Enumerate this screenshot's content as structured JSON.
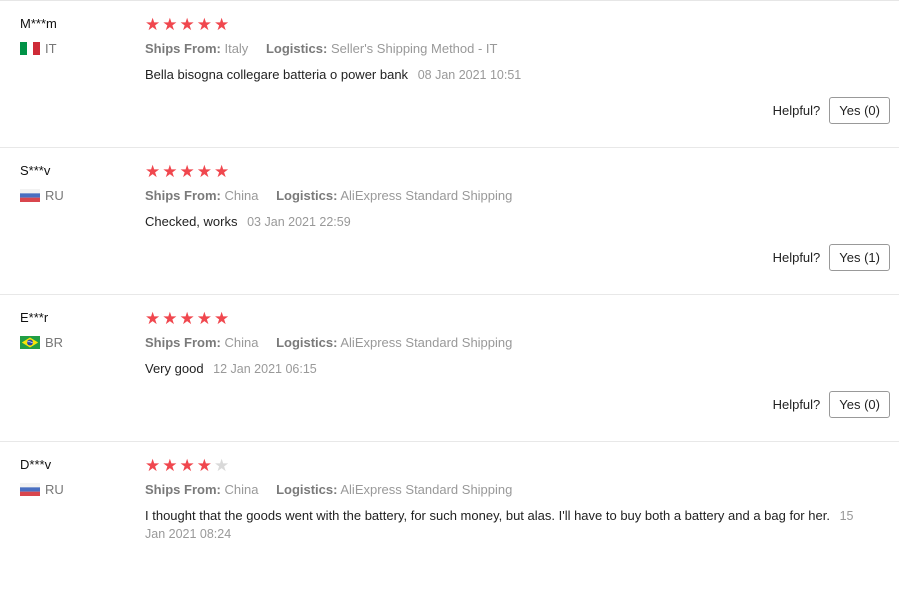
{
  "labels": {
    "ships_from": "Ships From:",
    "logistics": "Logistics:",
    "helpful": "Helpful?"
  },
  "colors": {
    "star_filled": "#f0474e",
    "star_empty": "#d9d9d9",
    "meta_text": "#999999"
  },
  "reviews": [
    {
      "user": "M***m",
      "country_code": "IT",
      "flag": "italy-flag-icon",
      "rating": 5,
      "ships_from": "Italy",
      "logistics": "Seller's Shipping Method - IT",
      "text": "Bella bisogna collegare batteria o power bank",
      "date": "08 Jan 2021 10:51",
      "helpful_button": "Yes (0)"
    },
    {
      "user": "S***v",
      "country_code": "RU",
      "flag": "russia-flag-icon",
      "rating": 5,
      "ships_from": "China",
      "logistics": "AliExpress Standard Shipping",
      "text": "Checked, works",
      "date": "03 Jan 2021 22:59",
      "helpful_button": "Yes (1)"
    },
    {
      "user": "E***r",
      "country_code": "BR",
      "flag": "brazil-flag-icon",
      "rating": 5,
      "ships_from": "China",
      "logistics": "AliExpress Standard Shipping",
      "text": "Very good",
      "date": "12 Jan 2021 06:15",
      "helpful_button": "Yes (0)"
    },
    {
      "user": "D***v",
      "country_code": "RU",
      "flag": "russia-flag-icon",
      "rating": 4,
      "ships_from": "China",
      "logistics": "AliExpress Standard Shipping",
      "text": "I thought that the goods went with the battery, for such money, but alas. I'll have to buy both a battery and a bag for her.",
      "date": "15 Jan 2021 08:24",
      "helpful_button": ""
    }
  ]
}
